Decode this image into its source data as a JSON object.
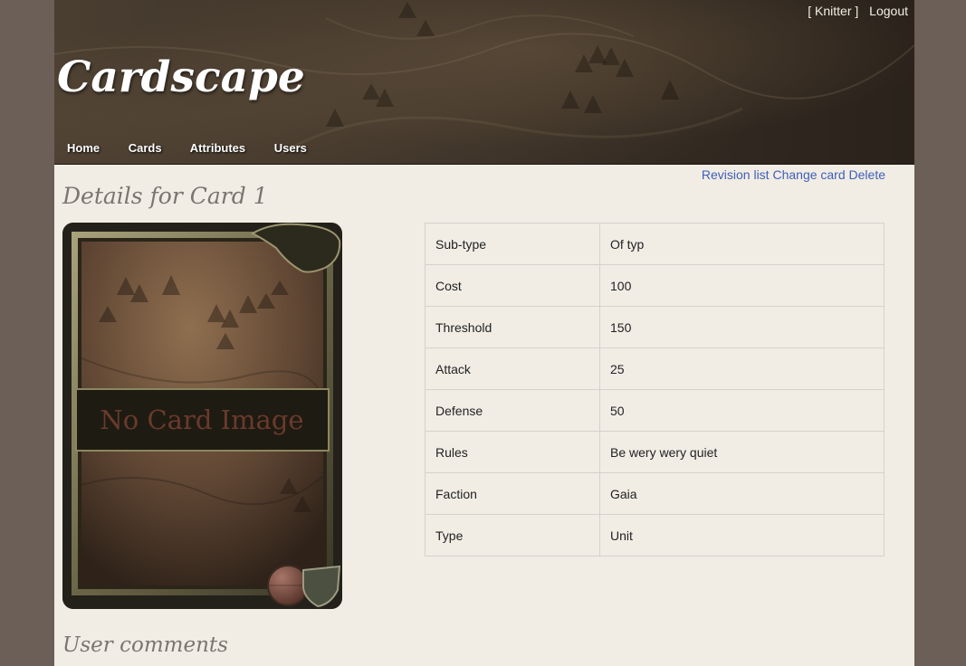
{
  "header": {
    "user": "[ Knitter ]",
    "logout": "Logout",
    "logo": "Cardscape"
  },
  "nav": {
    "items": [
      "Home",
      "Cards",
      "Attributes",
      "Users"
    ]
  },
  "actions": {
    "revision_list": "Revision list",
    "change_card": "Change card",
    "delete": "Delete"
  },
  "page": {
    "title": "Details for Card 1",
    "comments_title": "User comments"
  },
  "card": {
    "placeholder": "No Card Image"
  },
  "attributes": [
    {
      "key": "Sub-type",
      "value": "Of typ"
    },
    {
      "key": "Cost",
      "value": "100"
    },
    {
      "key": "Threshold",
      "value": "150"
    },
    {
      "key": "Attack",
      "value": "25"
    },
    {
      "key": "Defense",
      "value": "50"
    },
    {
      "key": "Rules",
      "value": "Be wery wery quiet"
    },
    {
      "key": "Faction",
      "value": "Gaia"
    },
    {
      "key": "Type",
      "value": "Unit"
    }
  ],
  "colors": {
    "background": "#6b5f58",
    "page": "#f1ede5",
    "link": "#3f5fb8",
    "heading": "#7a7570"
  }
}
